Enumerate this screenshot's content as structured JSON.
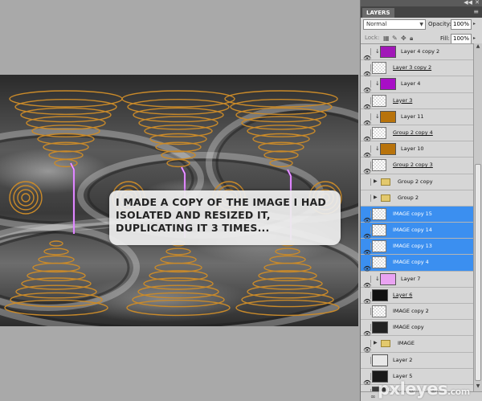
{
  "panel": {
    "tab_label": "LAYERS",
    "blend_mode": "Normal",
    "opacity_label": "Opacity:",
    "opacity_value": "100%",
    "lock_label": "Lock:",
    "fill_label": "Fill:",
    "fill_value": "100%"
  },
  "layers": [
    {
      "name": "Layer 4 copy 2",
      "thumb": "swatch",
      "color": "#a117b8",
      "clip": true,
      "selected": false,
      "underline": false
    },
    {
      "name": "Layer 3 copy 2",
      "thumb": "transparent",
      "clip": false,
      "selected": false,
      "underline": true
    },
    {
      "name": "Layer 4",
      "thumb": "swatch",
      "color": "#a80ec6",
      "clip": true,
      "selected": false,
      "underline": false
    },
    {
      "name": "Layer 3",
      "thumb": "transparent",
      "clip": false,
      "selected": false,
      "underline": true
    },
    {
      "name": "Layer 11",
      "thumb": "swatch",
      "color": "#b8730c",
      "clip": true,
      "selected": false,
      "underline": false
    },
    {
      "name": "Group 2 copy 4",
      "thumb": "transparent",
      "clip": false,
      "selected": false,
      "underline": true
    },
    {
      "name": "Layer 10",
      "thumb": "swatch",
      "color": "#b8730c",
      "clip": true,
      "selected": false,
      "underline": false
    },
    {
      "name": "Group 2 copy 3",
      "thumb": "transparent",
      "clip": false,
      "selected": false,
      "underline": true
    },
    {
      "name": "Group 2 copy",
      "thumb": "folder",
      "clip": false,
      "selected": false,
      "underline": false
    },
    {
      "name": "Group 2",
      "thumb": "folder",
      "clip": false,
      "selected": false,
      "underline": false
    },
    {
      "name": "IMAGE copy 15",
      "thumb": "transparent",
      "clip": false,
      "selected": true,
      "underline": false
    },
    {
      "name": "IMAGE copy 14",
      "thumb": "transparent",
      "clip": false,
      "selected": true,
      "underline": false
    },
    {
      "name": "IMAGE copy 13",
      "thumb": "transparent",
      "clip": false,
      "selected": true,
      "underline": false
    },
    {
      "name": "IMAGE copy 4",
      "thumb": "transparent",
      "clip": false,
      "selected": true,
      "underline": false
    },
    {
      "name": "Layer 7",
      "thumb": "swatch",
      "color": "#e9a3f2",
      "clip": true,
      "selected": false,
      "underline": false
    },
    {
      "name": "Layer 6",
      "thumb": "swatch",
      "color": "#111111",
      "clip": false,
      "selected": false,
      "underline": true
    },
    {
      "name": "IMAGE copy 2",
      "thumb": "transparent",
      "clip": false,
      "selected": false,
      "underline": false
    },
    {
      "name": "IMAGE copy",
      "thumb": "swatch",
      "color": "#222222",
      "clip": false,
      "selected": false,
      "underline": false
    },
    {
      "name": "IMAGE",
      "thumb": "folder",
      "clip": false,
      "selected": false,
      "underline": false
    },
    {
      "name": "Layer 2",
      "thumb": "swatch",
      "color": "#e8e8e8",
      "clip": false,
      "selected": false,
      "underline": false
    },
    {
      "name": "Layer 5",
      "thumb": "swatch",
      "color": "#1a1a1a",
      "clip": false,
      "selected": false,
      "underline": false
    },
    {
      "name": "Background copy",
      "thumb": "swatch",
      "color": "#3a3a3a",
      "clip": false,
      "selected": false,
      "underline": false
    }
  ],
  "callout": {
    "line1": "I MADE A COPY OF THE IMAGE I HAD",
    "line2": "ISOLATED AND RESIZED IT,",
    "line3": "DUPLICATING IT 3 TIMES..."
  },
  "watermark": {
    "text": "pxleyes",
    "suffix": ".com"
  },
  "colors": {
    "selection": "#3b8ff0",
    "lightning": "#cc44ff",
    "gold": "#c98a2a"
  }
}
